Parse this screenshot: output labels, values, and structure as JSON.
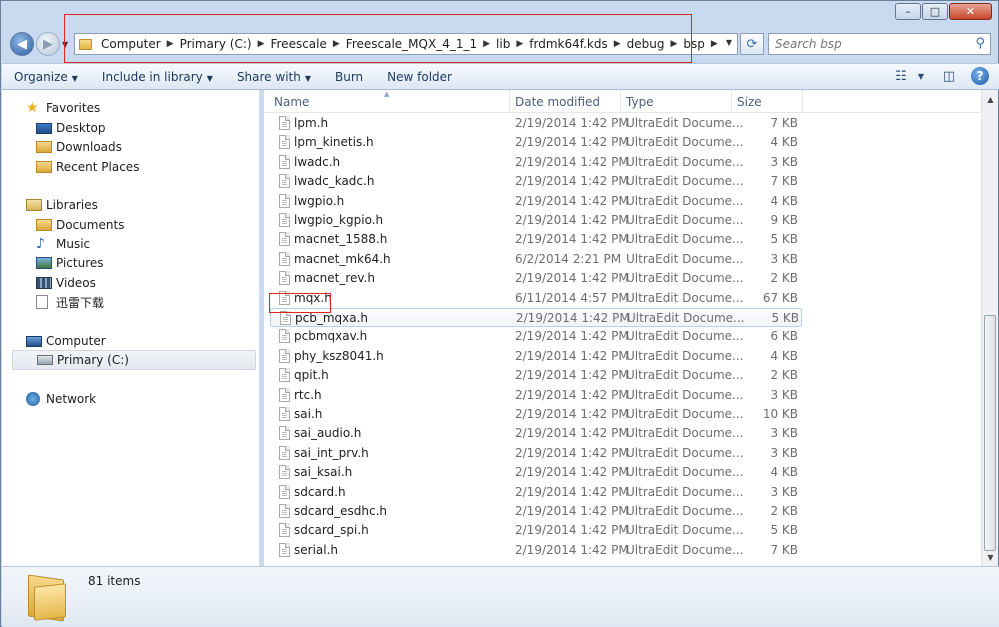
{
  "window": {
    "controls": [
      "minimize",
      "maximize",
      "close"
    ],
    "minimize_glyph": "–",
    "maximize_glyph": "□",
    "close_glyph": "✕"
  },
  "address": {
    "breadcrumbs": [
      "Computer",
      "Primary (C:)",
      "Freescale",
      "Freescale_MQX_4_1_1",
      "lib",
      "frdmk64f.kds",
      "debug",
      "bsp"
    ],
    "separator": "▶"
  },
  "search": {
    "placeholder": "Search bsp"
  },
  "toolbar": {
    "organize": "Organize",
    "include_in_library": "Include in library",
    "share_with": "Share with",
    "burn": "Burn",
    "new_folder": "New folder"
  },
  "nav": {
    "favorites": "Favorites",
    "desktop": "Desktop",
    "downloads": "Downloads",
    "recent_places": "Recent Places",
    "libraries": "Libraries",
    "documents": "Documents",
    "music": "Music",
    "pictures": "Pictures",
    "videos": "Videos",
    "xunlei": "迅雷下载",
    "computer": "Computer",
    "primary_c": "Primary (C:)",
    "network": "Network"
  },
  "columns": {
    "name": "Name",
    "date": "Date modified",
    "type": "Type",
    "size": "Size"
  },
  "files": [
    {
      "name": "lpm.h",
      "date": "2/19/2014 1:42 PM",
      "type": "UltraEdit Docume...",
      "size": "7 KB"
    },
    {
      "name": "lpm_kinetis.h",
      "date": "2/19/2014 1:42 PM",
      "type": "UltraEdit Docume...",
      "size": "4 KB"
    },
    {
      "name": "lwadc.h",
      "date": "2/19/2014 1:42 PM",
      "type": "UltraEdit Docume...",
      "size": "3 KB"
    },
    {
      "name": "lwadc_kadc.h",
      "date": "2/19/2014 1:42 PM",
      "type": "UltraEdit Docume...",
      "size": "7 KB"
    },
    {
      "name": "lwgpio.h",
      "date": "2/19/2014 1:42 PM",
      "type": "UltraEdit Docume...",
      "size": "4 KB"
    },
    {
      "name": "lwgpio_kgpio.h",
      "date": "2/19/2014 1:42 PM",
      "type": "UltraEdit Docume...",
      "size": "9 KB"
    },
    {
      "name": "macnet_1588.h",
      "date": "2/19/2014 1:42 PM",
      "type": "UltraEdit Docume...",
      "size": "5 KB"
    },
    {
      "name": "macnet_mk64.h",
      "date": "6/2/2014 2:21 PM",
      "type": "UltraEdit Docume...",
      "size": "3 KB"
    },
    {
      "name": "macnet_rev.h",
      "date": "2/19/2014 1:42 PM",
      "type": "UltraEdit Docume...",
      "size": "2 KB"
    },
    {
      "name": "mqx.h",
      "date": "6/11/2014 4:57 PM",
      "type": "UltraEdit Docume...",
      "size": "67 KB"
    },
    {
      "name": "pcb_mqxa.h",
      "date": "2/19/2014 1:42 PM",
      "type": "UltraEdit Docume...",
      "size": "5 KB"
    },
    {
      "name": "pcbmqxav.h",
      "date": "2/19/2014 1:42 PM",
      "type": "UltraEdit Docume...",
      "size": "6 KB"
    },
    {
      "name": "phy_ksz8041.h",
      "date": "2/19/2014 1:42 PM",
      "type": "UltraEdit Docume...",
      "size": "4 KB"
    },
    {
      "name": "qpit.h",
      "date": "2/19/2014 1:42 PM",
      "type": "UltraEdit Docume...",
      "size": "2 KB"
    },
    {
      "name": "rtc.h",
      "date": "2/19/2014 1:42 PM",
      "type": "UltraEdit Docume...",
      "size": "3 KB"
    },
    {
      "name": "sai.h",
      "date": "2/19/2014 1:42 PM",
      "type": "UltraEdit Docume...",
      "size": "10 KB"
    },
    {
      "name": "sai_audio.h",
      "date": "2/19/2014 1:42 PM",
      "type": "UltraEdit Docume...",
      "size": "3 KB"
    },
    {
      "name": "sai_int_prv.h",
      "date": "2/19/2014 1:42 PM",
      "type": "UltraEdit Docume...",
      "size": "3 KB"
    },
    {
      "name": "sai_ksai.h",
      "date": "2/19/2014 1:42 PM",
      "type": "UltraEdit Docume...",
      "size": "4 KB"
    },
    {
      "name": "sdcard.h",
      "date": "2/19/2014 1:42 PM",
      "type": "UltraEdit Docume...",
      "size": "3 KB"
    },
    {
      "name": "sdcard_esdhc.h",
      "date": "2/19/2014 1:42 PM",
      "type": "UltraEdit Docume...",
      "size": "2 KB"
    },
    {
      "name": "sdcard_spi.h",
      "date": "2/19/2014 1:42 PM",
      "type": "UltraEdit Docume...",
      "size": "5 KB"
    },
    {
      "name": "serial.h",
      "date": "2/19/2014 1:42 PM",
      "type": "UltraEdit Docume...",
      "size": "7 KB"
    }
  ],
  "hovered_file": "pcb_mqxa.h",
  "highlighted_file": "mqx.h",
  "status": {
    "item_count": "81 items"
  },
  "colors": {
    "highlight_box": "#e02424",
    "chrome": "#c9daf0",
    "hover_border": "#b8d0ec"
  }
}
